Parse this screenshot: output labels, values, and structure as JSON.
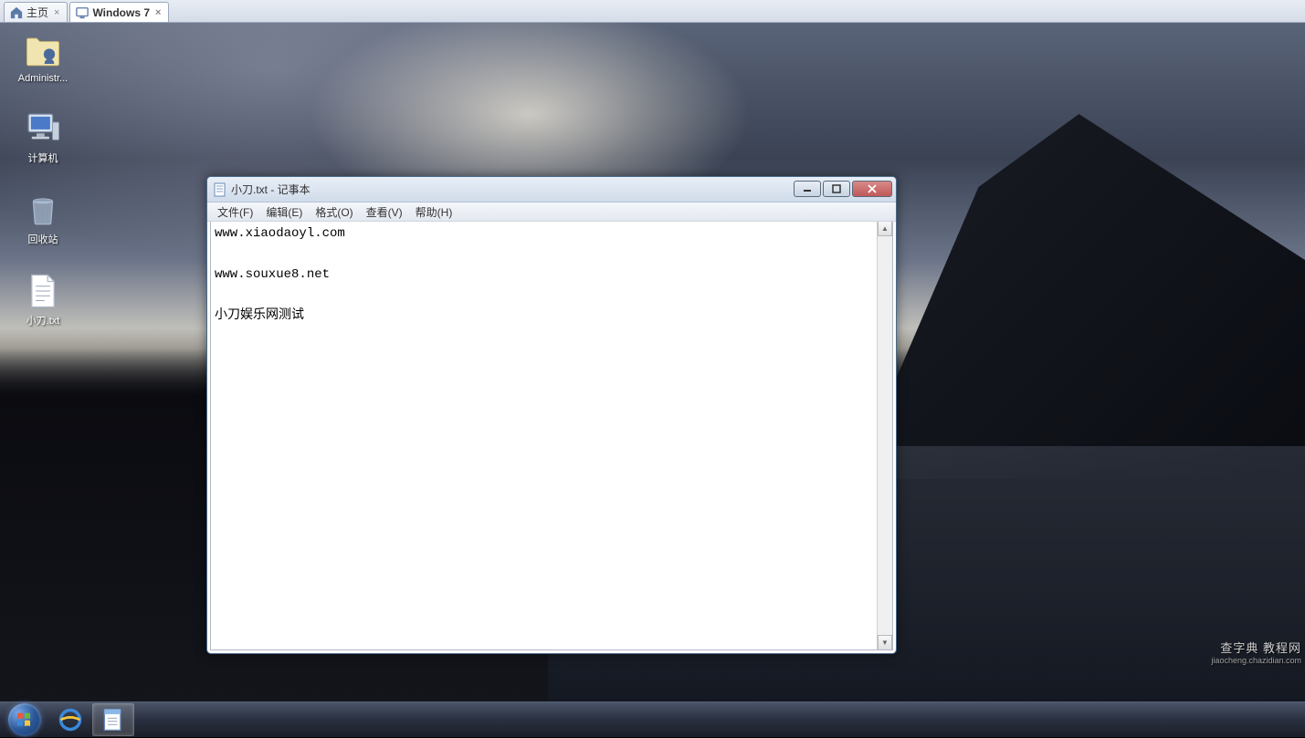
{
  "tabs": [
    {
      "label": "主页",
      "active": false
    },
    {
      "label": "Windows 7",
      "active": true
    }
  ],
  "desktop_icons": [
    {
      "name": "administrator",
      "label": "Administr..."
    },
    {
      "name": "computer",
      "label": "计算机"
    },
    {
      "name": "recycle-bin",
      "label": "回收站"
    },
    {
      "name": "text-file",
      "label": "小刀.txt"
    }
  ],
  "notepad": {
    "title": "小刀.txt - 记事本",
    "menu": {
      "file": "文件(F)",
      "edit": "编辑(E)",
      "format": "格式(O)",
      "view": "查看(V)",
      "help": "帮助(H)"
    },
    "content": "www.xiaodaoyl.com\n\nwww.souxue8.net\n\n小刀娱乐网测试"
  },
  "watermark": {
    "main": "查字典 教程网",
    "sub": "jiaocheng.chazidian.com"
  }
}
